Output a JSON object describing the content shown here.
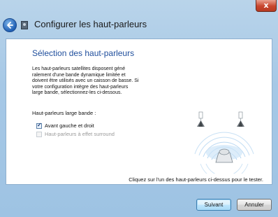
{
  "window": {
    "title": "Configurer les haut-parleurs",
    "close_label": "x"
  },
  "page": {
    "heading": "Sélection des haut-parleurs",
    "description_lines": [
      "Les haut-parleurs satellites disposent géné",
      "ralement d'une bande dynamique limitée et",
      "doivent être utilisés avec un caisson de basse. Si",
      "votre configuration intègre des haut-parleurs",
      "large bande, sélectionnez-les ci-dessous."
    ],
    "wideband_label": "Haut-parleurs large bande :",
    "options": [
      {
        "label": "Avant gauche et droit",
        "checked": true,
        "enabled": true
      },
      {
        "label": "Haut-parleurs à effet surround",
        "checked": false,
        "enabled": false
      }
    ],
    "hint": "Cliquez sur l'un des haut-parleurs ci-dessus pour le tester."
  },
  "buttons": {
    "next": "Suivant",
    "cancel": "Annuler"
  },
  "icons": {
    "back": "back-arrow-icon",
    "app": "speaker-app-icon",
    "speaker": "speaker-icon",
    "listener": "listener-icon"
  },
  "colors": {
    "heading": "#1f4e9c",
    "frame": "#a6c8e6",
    "close": "#c8452d",
    "sound_wave": "#9cc8ec"
  }
}
